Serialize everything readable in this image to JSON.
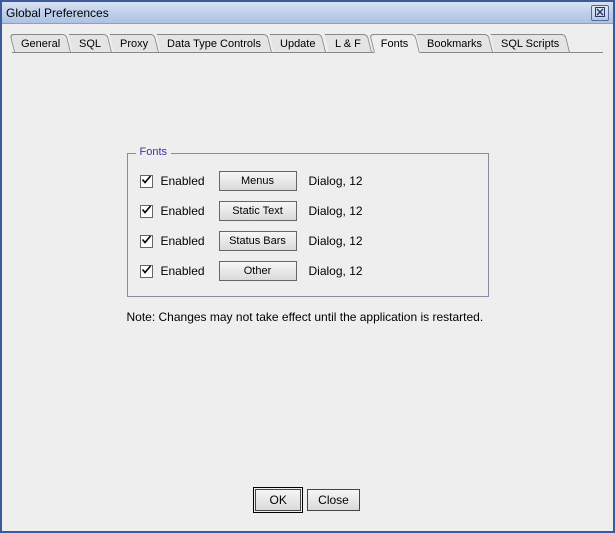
{
  "window": {
    "title": "Global Preferences"
  },
  "tabs": [
    {
      "label": "General"
    },
    {
      "label": "SQL"
    },
    {
      "label": "Proxy"
    },
    {
      "label": "Data Type Controls"
    },
    {
      "label": "Update"
    },
    {
      "label": "L & F"
    },
    {
      "label": "Fonts"
    },
    {
      "label": "Bookmarks"
    },
    {
      "label": "SQL Scripts"
    }
  ],
  "active_tab_index": 6,
  "fonts_panel": {
    "legend": "Fonts",
    "rows": [
      {
        "enabled_label": "Enabled",
        "button": "Menus",
        "desc": "Dialog, 12"
      },
      {
        "enabled_label": "Enabled",
        "button": "Static Text",
        "desc": "Dialog, 12"
      },
      {
        "enabled_label": "Enabled",
        "button": "Status Bars",
        "desc": "Dialog, 12"
      },
      {
        "enabled_label": "Enabled",
        "button": "Other",
        "desc": "Dialog, 12"
      }
    ],
    "note": "Note: Changes may not take effect until the application is restarted."
  },
  "buttons": {
    "ok": "OK",
    "close": "Close"
  }
}
